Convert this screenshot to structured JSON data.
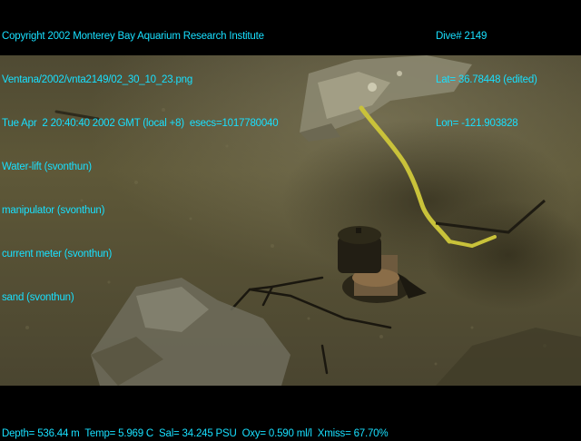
{
  "header": {
    "copyright": "Copyright 2002 Monterey Bay Aquarium Research Institute",
    "file": "Ventana/2002/vnta2149/02_30_10_23.png",
    "datetime": "Tue Apr  2 20:40:40 2002 GMT (local +8)  esecs=1017780040",
    "annotations": [
      "Water-lift (svonthun)",
      "manipulator (svonthun)",
      "current meter (svonthun)",
      "sand (svonthun)"
    ]
  },
  "nav": {
    "dive": "Dive# 2149",
    "lat": "Lat= 36.78448 (edited)",
    "lon": "Lon= -121.903828"
  },
  "footer": {
    "telemetry": "Depth= 536.44 m  Temp= 5.969 C  Sal= 34.245 PSU  Oxy= 0.590 ml/l  Xmiss= 67.70%"
  },
  "colors": {
    "overlay_text": "#18e0ff",
    "background": "#000000",
    "sediment": "#5b5536"
  }
}
